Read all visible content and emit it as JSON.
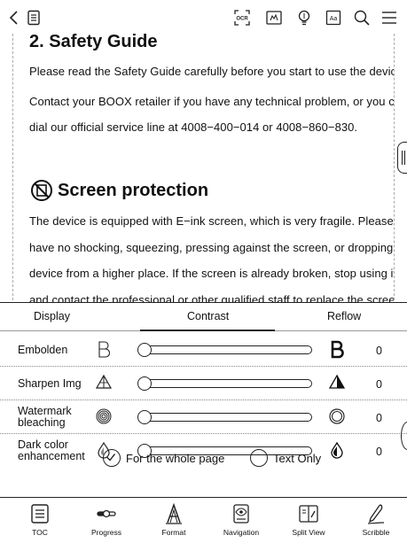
{
  "topbar": {
    "icons": [
      "back-icon",
      "document-icon",
      "ocr-icon",
      "touch-icon",
      "bulb-icon",
      "font-icon",
      "search-icon",
      "menu-icon"
    ],
    "ocr_label": "OCR",
    "font_label": "Aa"
  },
  "page": {
    "title": "2. Safety Guide",
    "lines": [
      "Please read the Safety Guide carefully before you start to use the device.",
      "Contact your BOOX retailer if you have any technical problem, or you can",
      "dial our official service line at 4008−400−014 or 4008−860−830."
    ],
    "section_heading": "Screen protection",
    "section_lines": [
      "The device is equipped with E−ink screen, which is very fragile. Please",
      "have no shocking, squeezing, pressing against the screen, or dropping the",
      "device from a higher place. If the screen is already broken, stop using it",
      "and contact the professional or other qualified staff to replace the screen"
    ]
  },
  "panel": {
    "tabs": [
      "Display",
      "Contrast",
      "Reflow"
    ],
    "active_tab": "Contrast",
    "rows": [
      {
        "label": "Embolden",
        "value": "0",
        "level": 0
      },
      {
        "label": "Sharpen Img",
        "value": "0",
        "level": 0
      },
      {
        "label": "Watermark\nbleaching",
        "value": "0",
        "level": 0
      },
      {
        "label": "Dark color\nenhancement",
        "value": "0",
        "level": 0
      }
    ],
    "options": [
      {
        "label": "For the whole page",
        "checked": true
      },
      {
        "label": "Text Only",
        "checked": false
      }
    ]
  },
  "bottombar": {
    "items": [
      {
        "label": "TOC",
        "icon": "toc-icon"
      },
      {
        "label": "Progress",
        "icon": "progress-icon"
      },
      {
        "label": "Format",
        "icon": "format-icon"
      },
      {
        "label": "Navigation",
        "icon": "navigation-icon"
      },
      {
        "label": "Split View",
        "icon": "split-view-icon"
      },
      {
        "label": "Scribble",
        "icon": "scribble-icon"
      }
    ]
  }
}
